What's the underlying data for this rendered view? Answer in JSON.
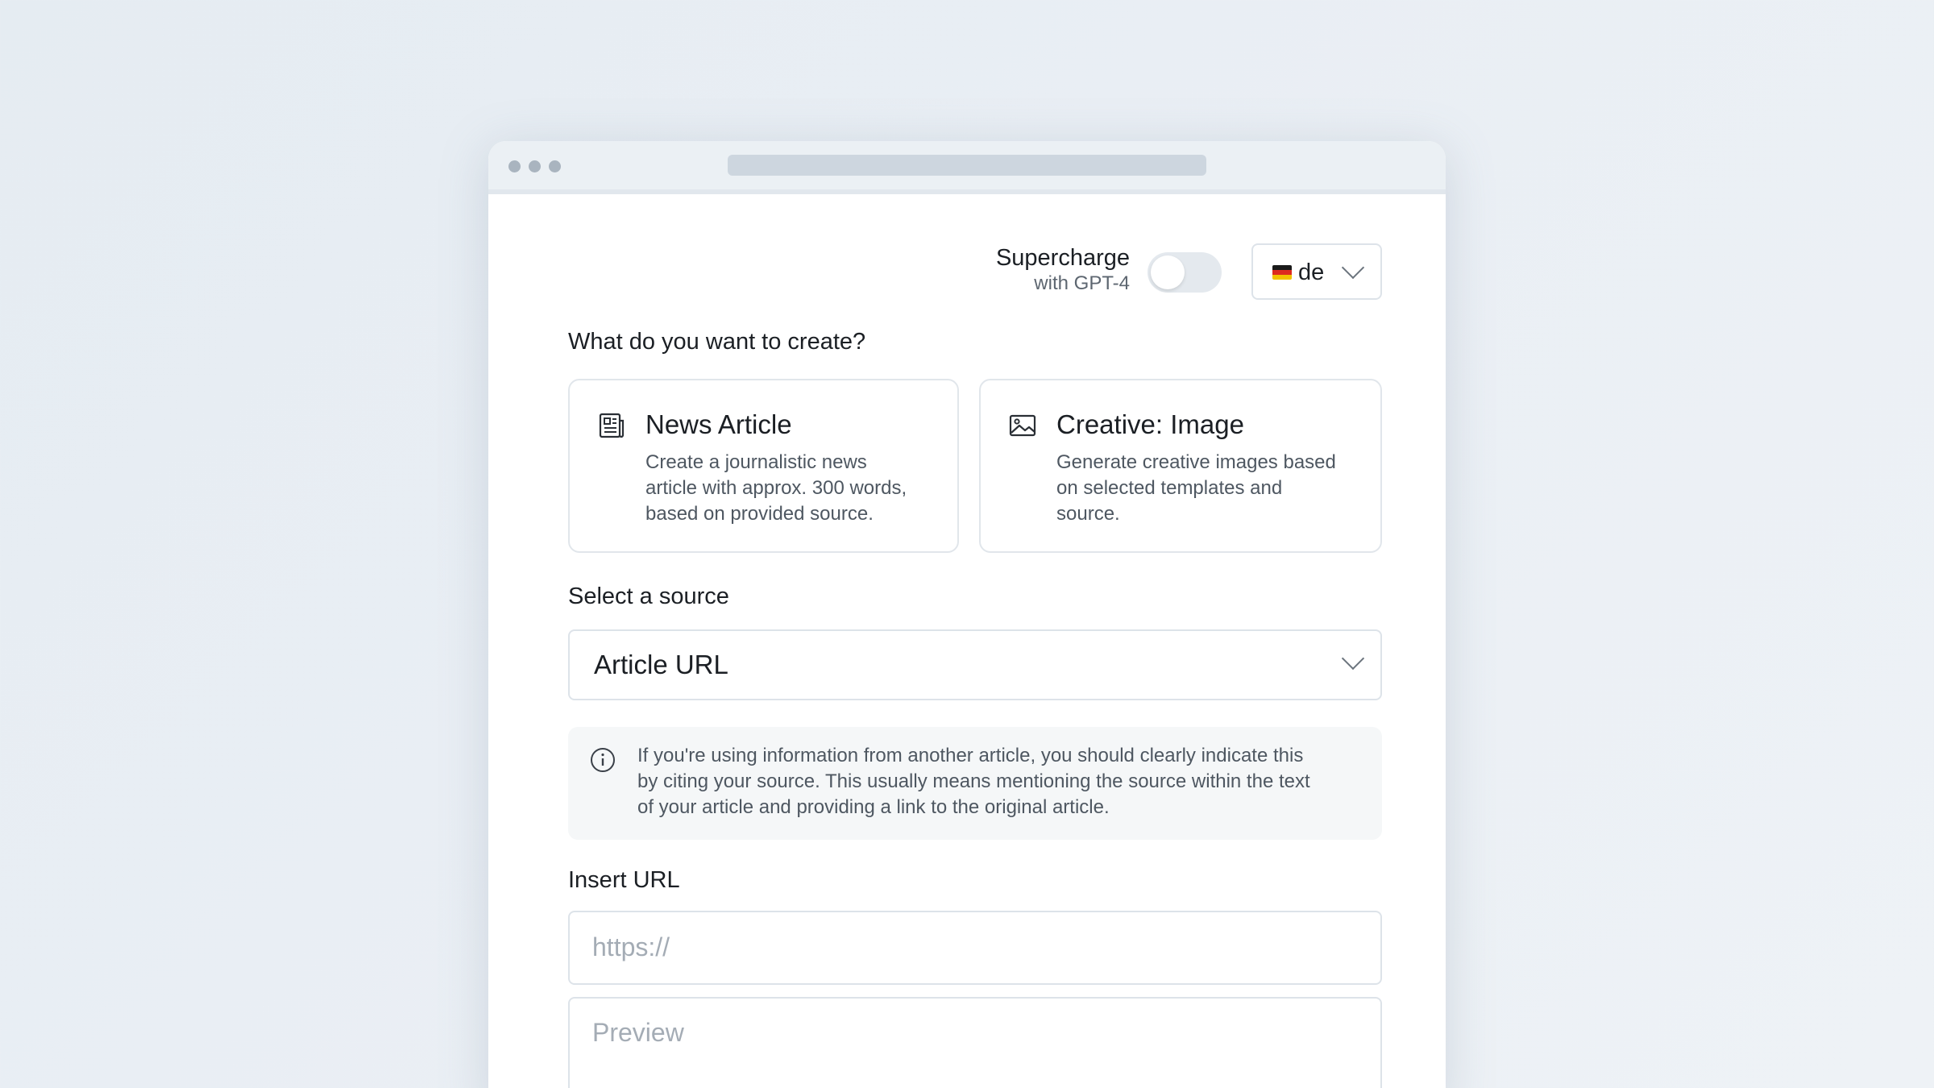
{
  "supercharge": {
    "title": "Supercharge",
    "subtitle": "with GPT-4",
    "enabled": false
  },
  "language": {
    "selected": "de",
    "flag_icon": "german-flag-icon"
  },
  "create": {
    "heading": "What do you want to create?",
    "options": [
      {
        "icon": "newspaper-icon",
        "title": "News Article",
        "description_lines": [
          "Create a journalistic news",
          "article with approx. 300 words,",
          "based on provided source."
        ]
      },
      {
        "icon": "image-icon",
        "title": "Creative: Image",
        "description_lines": [
          "Generate creative images based",
          "on selected templates and",
          "source."
        ]
      }
    ]
  },
  "source": {
    "heading": "Select a source",
    "selected": "Article URL"
  },
  "info": {
    "icon": "info-icon",
    "lines": [
      "If you're using information from another article, you should clearly indicate this",
      "by citing your source. This usually means mentioning the source within the text",
      "of your article and providing a link to the original article."
    ]
  },
  "url": {
    "heading": "Insert URL",
    "placeholder": "https://",
    "preview_placeholder": "Preview"
  },
  "colors": {
    "page_bg": "#e7edf3",
    "text_primary": "#1b1f24",
    "text_secondary": "#4e5761",
    "border": "#dde3e9"
  }
}
